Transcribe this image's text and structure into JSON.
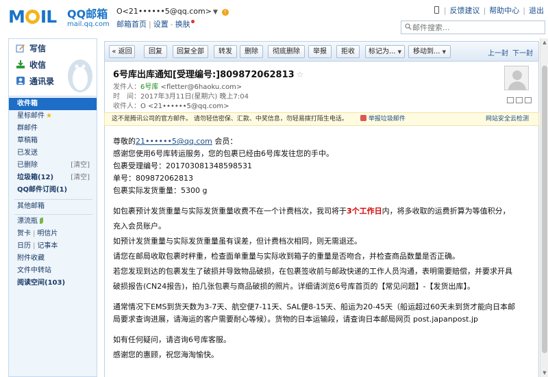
{
  "brand": {
    "logo_text": "MOIL",
    "logo_cn": "QQ邮箱",
    "logo_en": "mail.qq.com"
  },
  "account": {
    "address": "O<21••••••5@qq.com>",
    "links": [
      "邮箱首页",
      "设置",
      "换肤"
    ]
  },
  "top_links": [
    "反馈建议",
    "帮助中心",
    "退出"
  ],
  "search": {
    "placeholder": "邮件搜索..."
  },
  "nav": {
    "quick": [
      "写信",
      "收信",
      "通讯录"
    ],
    "folders": [
      {
        "label": "收件箱",
        "selected": true
      },
      {
        "label": "星标邮件"
      },
      {
        "label": "群邮件"
      },
      {
        "label": "草稿箱"
      },
      {
        "label": "已发送"
      },
      {
        "label": "已删除",
        "clear": "[清空]"
      },
      {
        "label": "垃圾箱(12)",
        "clear": "[清空]",
        "bold": true
      },
      {
        "label": "QQ邮件订阅(1)",
        "bold": true
      },
      {
        "label": "其他邮箱"
      },
      {
        "label": "漂流瓶"
      },
      {
        "label": "贺卡",
        "pair": "明信片"
      },
      {
        "label": "日历",
        "pair": "记事本"
      },
      {
        "label": "附件收藏"
      },
      {
        "label": "文件中转站"
      },
      {
        "label": "阅读空间(103)",
        "bold": true
      }
    ]
  },
  "toolbar": {
    "buttons": [
      "« 返回",
      "回复",
      "回复全部",
      "转发",
      "删除",
      "彻底删除",
      "举报",
      "拒收",
      "标记为...",
      "移动到..."
    ],
    "prev": "上一封",
    "next": "下一封"
  },
  "mail": {
    "subject": "6号库出库通知[受理编号:]809872062813",
    "from_label": "发件人：",
    "from_name": "6号库",
    "from_addr": "<fletter@6haoku.com>",
    "time_label": "时　间：",
    "time": "2017年3月11日(星期六) 晚上7:04",
    "to_label": "收件人：",
    "to": "O <21••••••5@qq.com>"
  },
  "notice": {
    "text": "这不是腾讯公司的官方邮件。 请勿轻信密保、汇款、中奖信息，勿轻易拨打陌生电话。",
    "report": "举报垃圾邮件",
    "right": "网站安全云检测"
  },
  "body": {
    "greeting_prefix": "尊敬的",
    "greeting_addr": "21••••••5@qq.com",
    "greeting_suffix": " 会员：",
    "line1": "感谢您使用6号库转运服务，您的包裹已经由6号库发往您的手中。",
    "line2": "包裹受理编号：201703081348598531",
    "line3": "单号：809872062813",
    "line4": "包裹实际发货重量：5300 g",
    "p1_a": "如包裹预计发货重量与实际发货重量收费不在一个计费档次，我司将于",
    "p1_hl": "3个工作日",
    "p1_b": "内，将多收取的运费折算为等值积分，",
    "p1_c": "充入会员账户。",
    "p2": "如预计发货重量与实际发货重量虽有误差，但计费档次相同，则无需退还。",
    "p3": "请您在邮局收取包裹时秤重，检查面单重量与实际收到箱子的重量是否吻合，并检查商品数量是否正确。",
    "p4_a": "若您发现到达的包裹发生了破损并导致物品破损，在包裹签收前与邮政快递的工作人员沟通，表明需要赔偿，并要求开具",
    "p4_b": "破损报告(CN24报告)，拍几张包裹与商品破损的照片。详细请浏览6号库首页的【常见问题】-【发货出库】。",
    "p5_a": "通常情况下EMS到货天数为3-7天、航空便7-11天、SAL便8-15天、船运为20-45天（船运超过60天未到货才能向日本邮",
    "p5_b": "局要求查询进展，请海运的客户需要耐心等候）。货物的日本运输段，请查询日本邮局网页 post.japanpost.jp",
    "p6": "如有任何疑问，请咨询6号库客服。",
    "p7": "感谢您的惠顾，祝您海淘愉快。"
  }
}
